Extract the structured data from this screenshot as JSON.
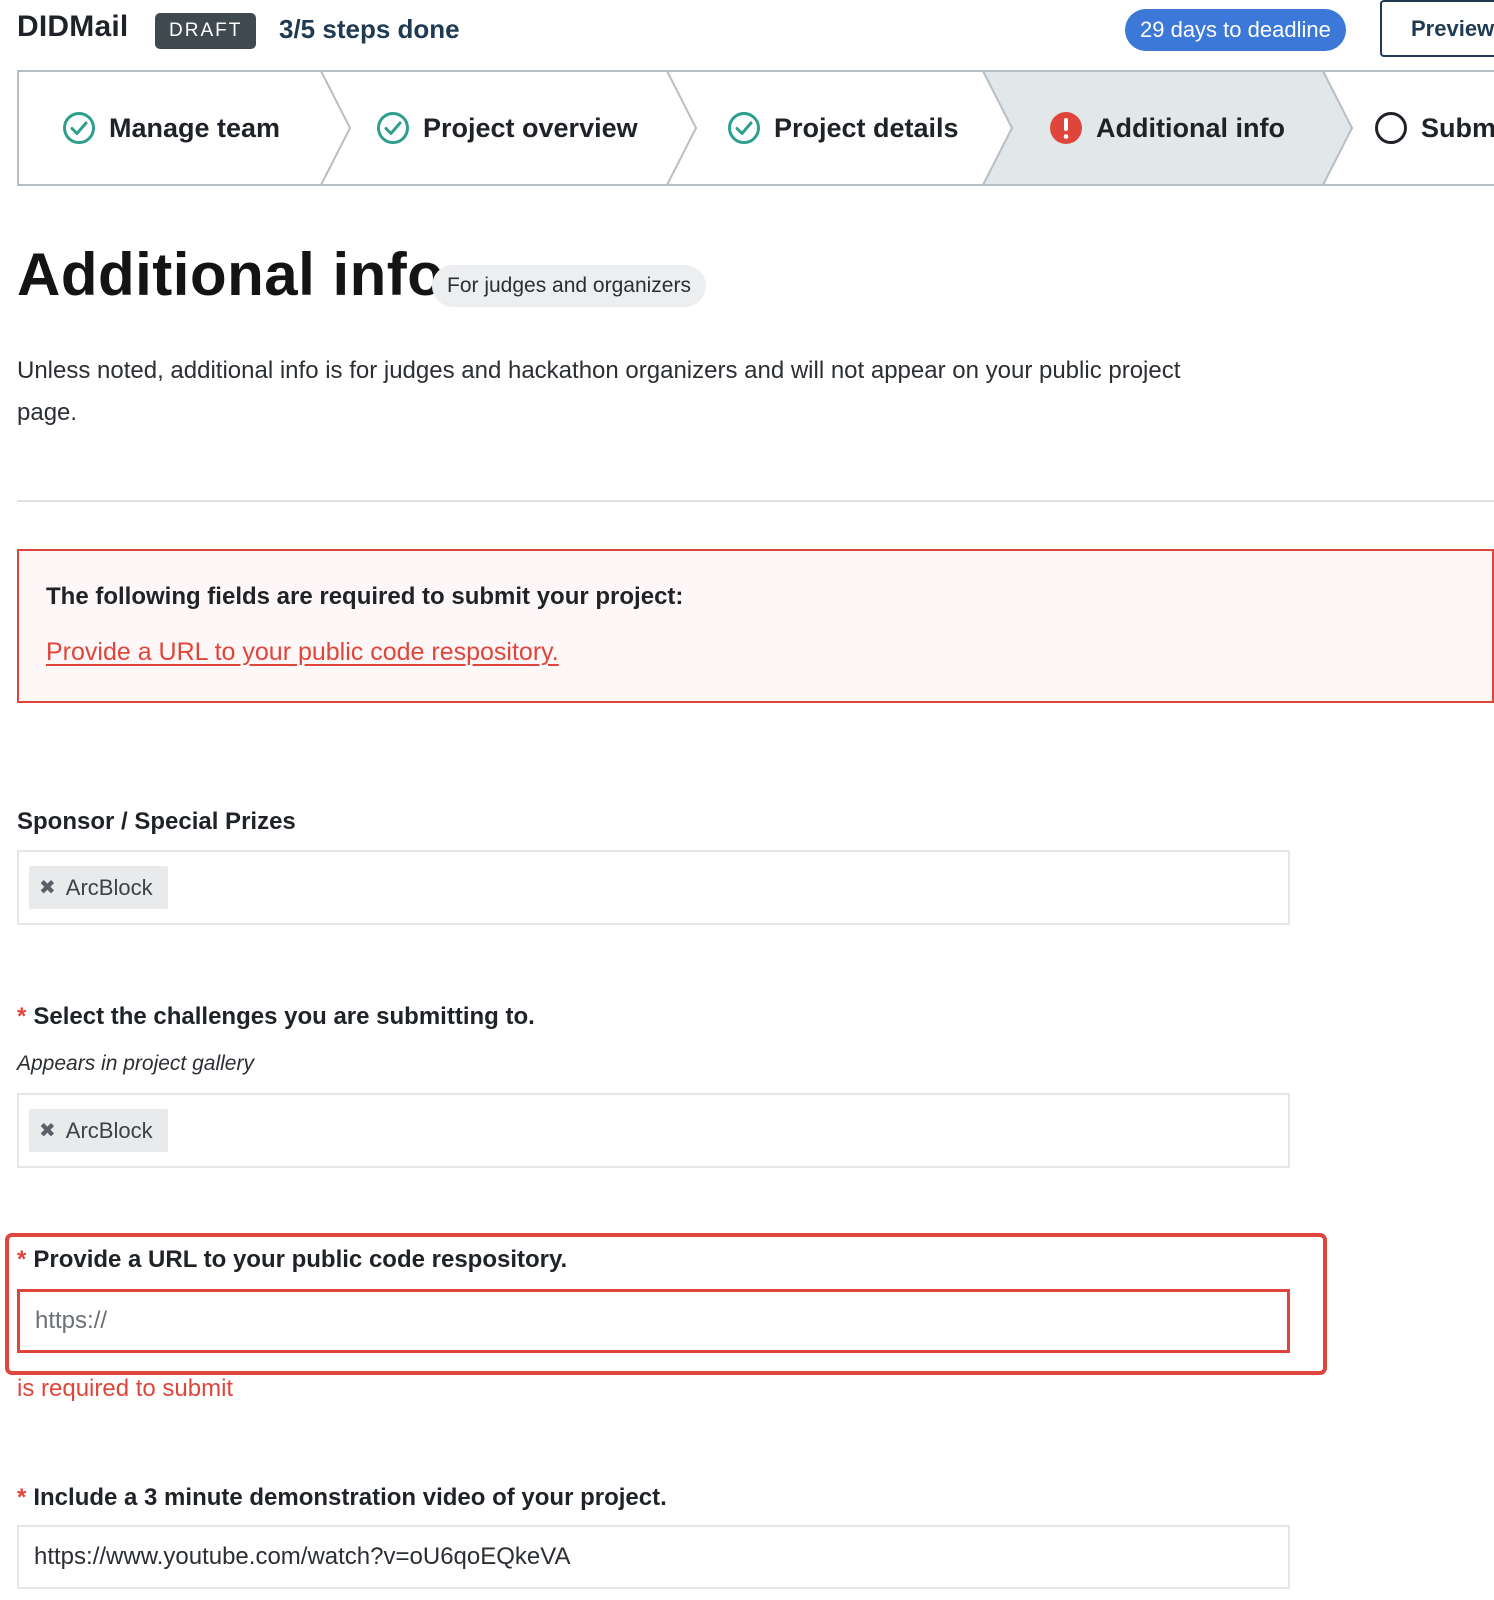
{
  "header": {
    "app_title": "DIDMail",
    "status_badge": "DRAFT",
    "progress": "3/5 steps done",
    "deadline": "29 days to deadline",
    "preview_label": "Preview"
  },
  "stepper": {
    "steps": [
      {
        "label": "Manage team",
        "state": "complete"
      },
      {
        "label": "Project overview",
        "state": "complete"
      },
      {
        "label": "Project details",
        "state": "complete"
      },
      {
        "label": "Additional info",
        "state": "error"
      },
      {
        "label": "Submit",
        "state": "pending"
      }
    ],
    "colors": {
      "complete": "#2f9e8f",
      "error": "#e0453b",
      "active_bg": "#e2e7e9",
      "border": "#b8bfc4"
    }
  },
  "page": {
    "title": "Additional info",
    "audience": "For judges and organizers",
    "intro": "Unless noted, additional info is for judges and hackathon organizers and will not appear on your public project page."
  },
  "alert": {
    "title": "The following fields are required to submit your project:",
    "link": "Provide a URL to your public code respository."
  },
  "fields": {
    "sponsor": {
      "label": "Sponsor / Special Prizes",
      "tags": [
        "ArcBlock"
      ]
    },
    "challenges": {
      "required_mark": "*",
      "label": "Select the challenges you are submitting to.",
      "hint": "Appears in project gallery",
      "tags": [
        "ArcBlock"
      ]
    },
    "repo_url": {
      "required_mark": "*",
      "label": "Provide a URL to your public code respository.",
      "placeholder": "https://",
      "value": "",
      "error": "is required to submit"
    },
    "video": {
      "required_mark": "*",
      "label": "Include a 3 minute demonstration video of your project.",
      "value": "https://www.youtube.com/watch?v=oU6qoEQkeVA"
    }
  },
  "colors": {
    "accent_blue": "#3b78d8",
    "error_red": "#e0453b",
    "dark_navy": "#1f3a52"
  }
}
